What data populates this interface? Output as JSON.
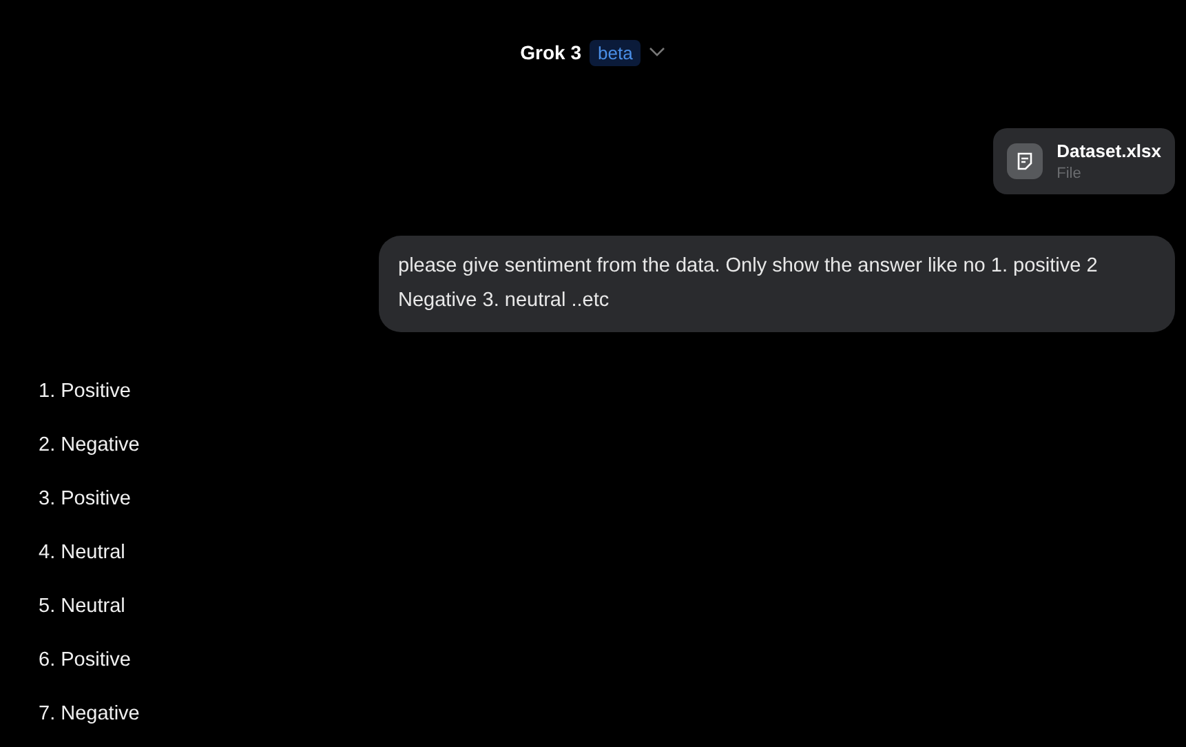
{
  "header": {
    "model": "Grok 3",
    "badge": "beta"
  },
  "attachment": {
    "name": "Dataset.xlsx",
    "type": "File"
  },
  "user_message": "please give sentiment from the data. Only show the answer like no 1. positive 2 Negative 3. neutral ..etc",
  "answer": [
    "1. Positive",
    "2. Negative",
    "3. Positive",
    "4. Neutral",
    "5. Neutral",
    "6. Positive",
    "7. Negative"
  ]
}
